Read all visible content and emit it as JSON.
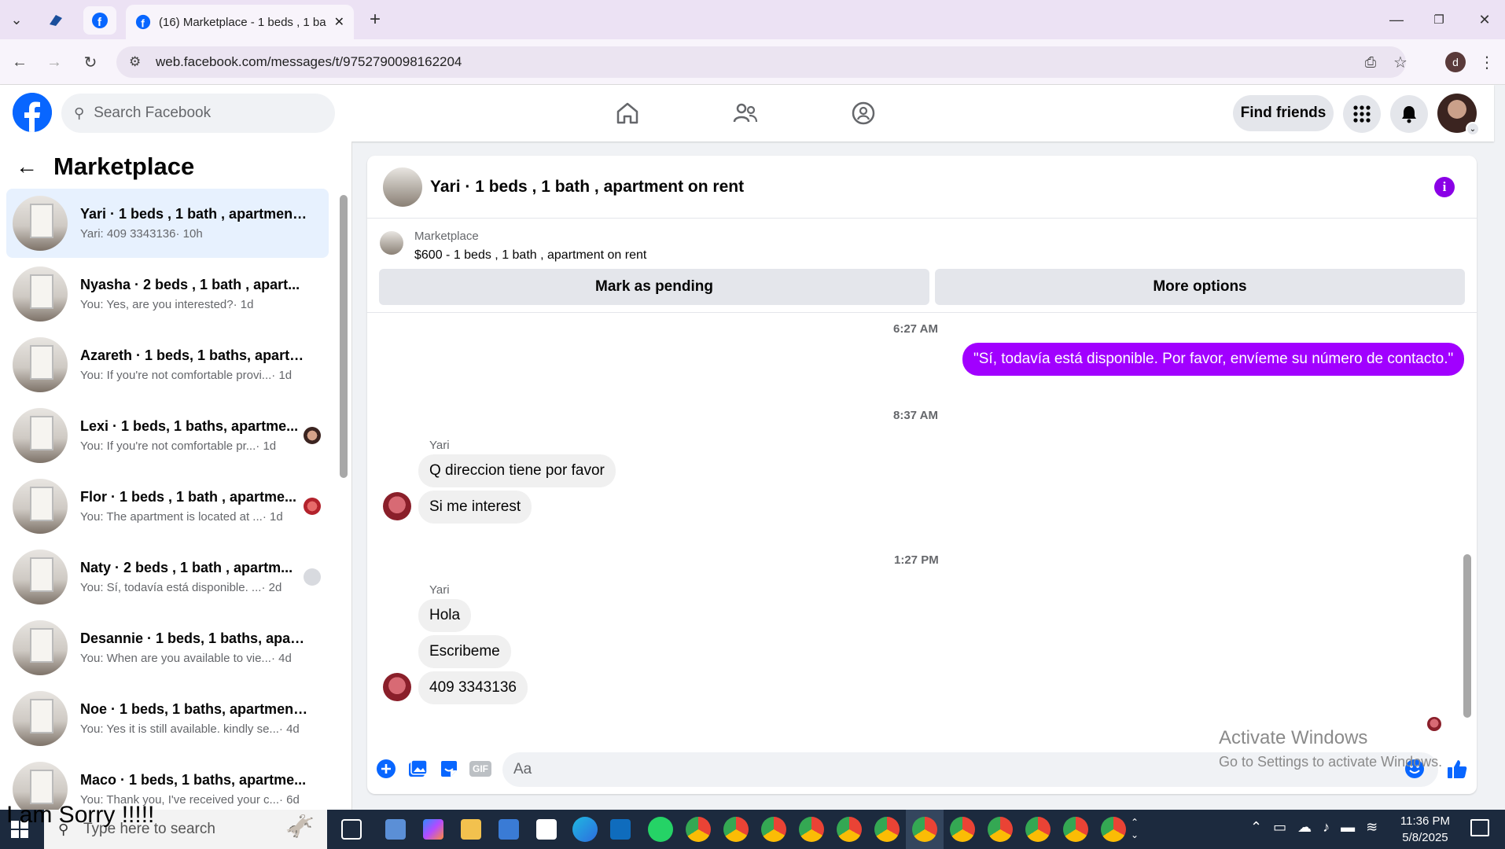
{
  "browser": {
    "tab_title": "(16) Marketplace - 1 beds , 1 ba",
    "url": "web.facebook.com/messages/t/9752790098162204",
    "profile_initial": "d"
  },
  "fb": {
    "search_placeholder": "Search Facebook",
    "find_friends": "Find friends"
  },
  "marketplace": {
    "title": "Marketplace",
    "conversations": [
      {
        "name": "Yari · 1 beds , 1 bath , apartment ...",
        "preview": "Yari: 409 3343136",
        "time": "· 10h"
      },
      {
        "name": "Nyasha · 2 beds , 1 bath , apart...",
        "preview": "You: Yes, are you interested?",
        "time": "· 1d"
      },
      {
        "name": "Azareth · 1 beds, 1 baths, apartm...",
        "preview": "You: If you're not comfortable provi...",
        "time": "· 1d"
      },
      {
        "name": "Lexi · 1 beds, 1 baths, apartme...",
        "preview": "You: If you're not comfortable pr...",
        "time": "· 1d"
      },
      {
        "name": "Flor · 1 beds , 1 bath , apartme...",
        "preview": "You: The apartment is located at ...",
        "time": "· 1d"
      },
      {
        "name": "Naty · 2 beds , 1 bath , apartm...",
        "preview": "You: Sí, todavía está disponible. ...",
        "time": "· 2d"
      },
      {
        "name": "Desannie · 1 beds, 1 baths, apart...",
        "preview": "You: When are you available to vie...",
        "time": "· 4d"
      },
      {
        "name": "Noe · 1 beds, 1 baths, apartment...",
        "preview": "You: Yes it is still available. kindly se...",
        "time": "· 4d"
      },
      {
        "name": "Maco · 1 beds, 1 baths, apartme...",
        "preview": "You: Thank you, I've received your c...",
        "time": "· 6d"
      }
    ]
  },
  "chat": {
    "title": "Yari · 1 beds , 1 bath , apartment on rent",
    "listing_source": "Marketplace",
    "listing_price": "$600 - 1 beds , 1 bath , apartment on rent",
    "mark_pending": "Mark as pending",
    "more_options": "More options",
    "messages": {
      "ts1": "6:27 AM",
      "out1": "\"Sí, todavía está disponible. Por favor, envíeme su número de contacto.\"",
      "ts2": "8:37 AM",
      "sender1": "Yari",
      "in1": "Q direccion tiene por favor",
      "in2": "Si me interest",
      "ts3": "1:27 PM",
      "sender2": "Yari",
      "in3": "Hola",
      "in4": "Escribeme",
      "in5": "409 3343136"
    },
    "composer_placeholder": "Aa",
    "gif_label": "GIF"
  },
  "watermark": {
    "line1": "Activate Windows",
    "line2": "Go to Settings to activate Windows."
  },
  "taskbar": {
    "search_placeholder": "Type here to search",
    "overlay_text": "I am Sorry !!!!!",
    "time": "11:36 PM",
    "date": "5/8/2025"
  }
}
